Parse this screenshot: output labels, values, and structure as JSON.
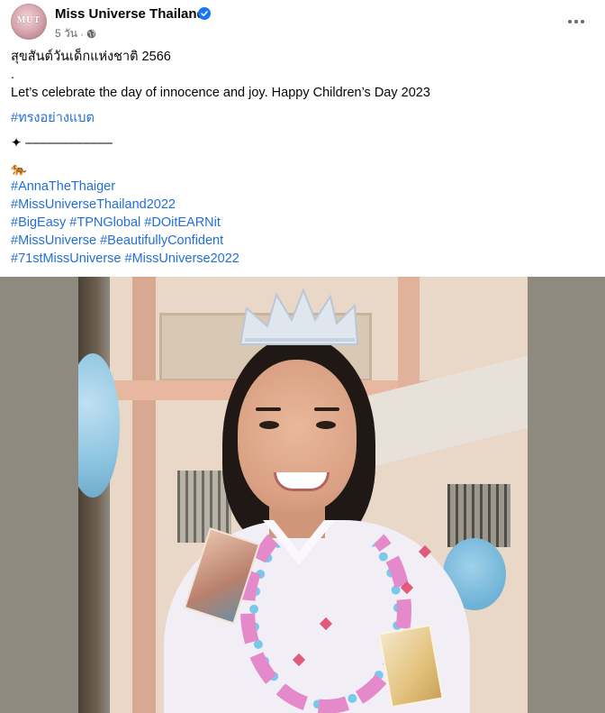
{
  "post": {
    "page_name": "Miss Universe Thailand",
    "avatar_text": "MUT",
    "time": "5 วัน",
    "separator": "·",
    "lines": {
      "thai": "สุขสันต์วันเด็กแห่งชาติ 2566",
      "dot": ".",
      "english": "Let’s celebrate the day of innocence and joy. Happy Children’s Day 2023",
      "tag_thai": "#ทรงอย่างแบต",
      "divider": "✦ ––––––––––––",
      "emoji": "🐅",
      "tags_1": "#AnnaTheThaiger",
      "tags_2": "#MissUniverseThailand2022",
      "tags_3": "#BigEasy #TPNGlobal #DOitEARNit",
      "tags_4": "#MissUniverse #BeautifullyConfident",
      "tags_5": "#71stMissUniverse #MissUniverse2022"
    }
  },
  "icons": {
    "verified": "verified-badge-icon",
    "globe": "globe-icon",
    "more": "more-options-icon"
  },
  "colors": {
    "link": "#216fdb",
    "verified": "#1877f2",
    "secondary_text": "#65676b"
  }
}
